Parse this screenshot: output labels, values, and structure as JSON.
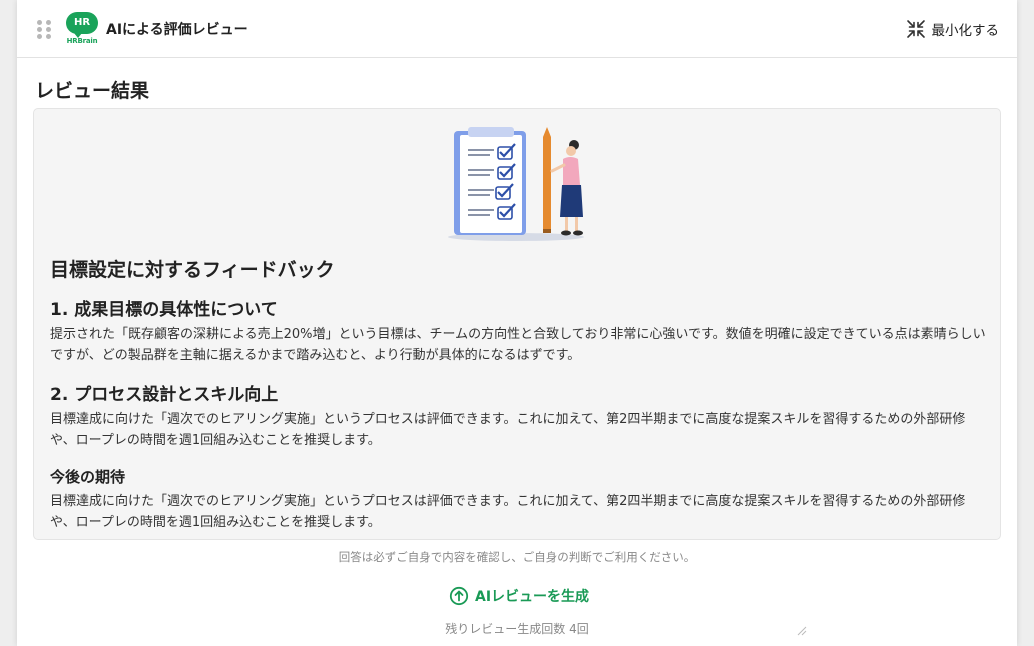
{
  "header": {
    "logo_badge": "HR",
    "logo_sub": "HRBrain",
    "title": "AIによる評価レビュー",
    "minimize_label": "最小化する"
  },
  "section_title": "レビュー結果",
  "review": {
    "heading": "目標設定に対するフィードバック",
    "items": [
      {
        "title": "1. 成果目標の具体性について",
        "body": "提示された「既存顧客の深耕による売上20%増」という目標は、チームの方向性と合致しており非常に心強いです。数値を明確に設定できている点は素晴らしいですが、どの製品群を主軸に据えるかまで踏み込むと、より行動が具体的になるはずです。"
      },
      {
        "title": "2. プロセス設計とスキル向上",
        "body": "目標達成に向けた「週次でのヒアリング実施」というプロセスは評価できます。これに加えて、第2四半期までに高度な提案スキルを習得するための外部研修や、ロープレの時間を週1回組み込むことを推奨します。"
      },
      {
        "title": "今後の期待",
        "body": "目標達成に向けた「週次でのヒアリング実施」というプロセスは評価できます。これに加えて、第2四半期までに高度な提案スキルを習得するための外部研修や、ロープレの時間を週1回組み込むことを推奨します。"
      }
    ]
  },
  "disclaimer": "回答は必ずご自身で内容を確認し、ご自身の判断でご利用ください。",
  "generate_label": "AIレビューを生成",
  "remaining_label": "残りレビュー生成回数 4回",
  "colors": {
    "brand_green": "#1aa35a",
    "action_green": "#1a9a56",
    "card_bg": "#f5f5f5"
  },
  "icons": {
    "drag": "drag-handle-icon",
    "minimize": "minimize-arrows-icon",
    "generate": "arrow-up-circle-icon",
    "resize": "resize-grip-icon"
  }
}
